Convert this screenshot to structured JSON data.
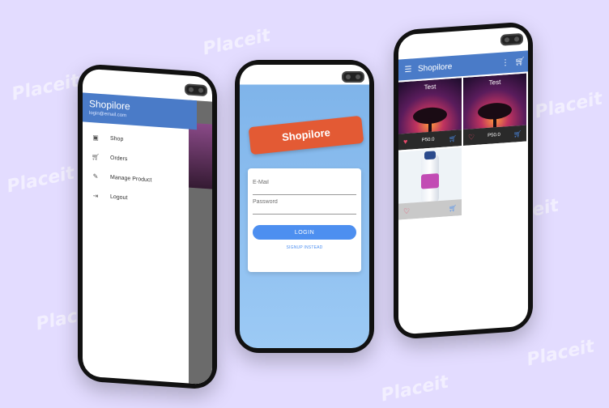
{
  "watermark": "Placeit",
  "drawer": {
    "title": "Shopilore",
    "email": "login@email.com",
    "items": [
      {
        "icon": "shop-icon",
        "label": "Shop"
      },
      {
        "icon": "cart-icon",
        "label": "Orders"
      },
      {
        "icon": "pencil-icon",
        "label": "Manage Product"
      },
      {
        "icon": "logout-icon",
        "label": "Logout"
      }
    ]
  },
  "login": {
    "brand": "Shopilore",
    "email_label": "E-Mail",
    "password_label": "Password",
    "login_button": "LOGIN",
    "signup_link": "SIGNUP INSTEAD"
  },
  "shop": {
    "title": "Shopilore",
    "products": [
      {
        "name": "Test",
        "price": "P50.0",
        "favorite": true
      },
      {
        "name": "Test",
        "price": "P50.0",
        "favorite": false
      },
      {
        "name": "",
        "price": "",
        "favorite": false
      }
    ]
  },
  "colors": {
    "background": "#e3dcff",
    "appbar": "#4a7bc8",
    "brand_banner": "#e35a34",
    "button": "#4d8ff0"
  }
}
